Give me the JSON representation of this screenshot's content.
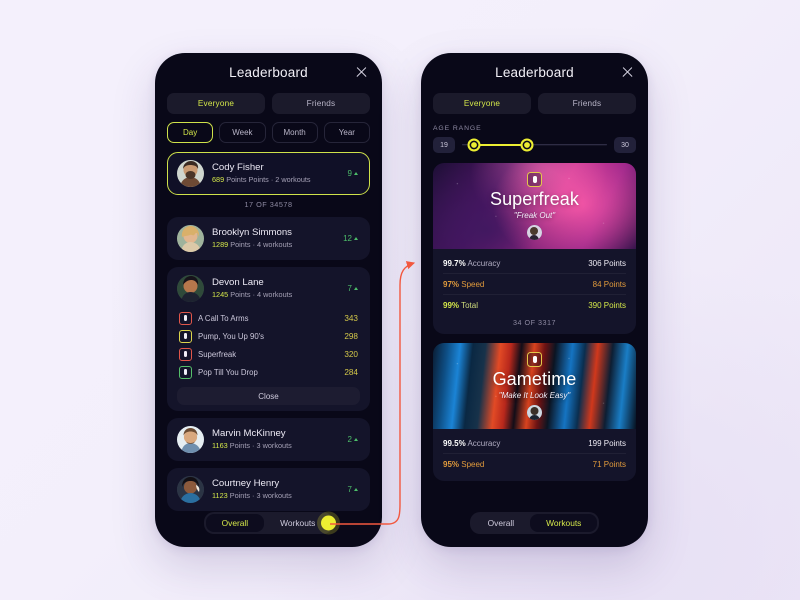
{
  "theme": {
    "accent_yellow": "#d5e84a",
    "accent_dot": "#ecee32",
    "orange": "#e09a3c",
    "green": "#4dbf6a",
    "card_bg": "#14142a",
    "phone_bg": "#090818",
    "page_bg": "#f2eefb",
    "connector": "#f2583f"
  },
  "left_phone": {
    "header": {
      "title": "Leaderboard",
      "close_icon": "close-icon"
    },
    "audience_tabs": [
      {
        "label": "Everyone",
        "active": true
      },
      {
        "label": "Friends",
        "active": false
      }
    ],
    "period_tabs": [
      {
        "label": "Day",
        "active": true
      },
      {
        "label": "Week",
        "active": false
      },
      {
        "label": "Month",
        "active": false
      },
      {
        "label": "Year",
        "active": false
      }
    ],
    "entries": [
      {
        "name": "Cody Fisher",
        "points": "689",
        "sub": " Points Points · 2 workouts",
        "rank": "9",
        "highlight": true,
        "meta": "17 OF 34578"
      },
      {
        "name": "Brooklyn Simmons",
        "points": "1289",
        "sub": " Points · 4 workouts",
        "rank": "12",
        "highlight": false
      },
      {
        "name": "Devon Lane",
        "points": "1245",
        "sub": " Points · 4 workouts",
        "rank": "7",
        "highlight": false,
        "expanded": true,
        "workouts": [
          {
            "name": "A Call To Arms",
            "score": "343",
            "color": "#e2564a"
          },
          {
            "name": "Pump, You Up 90's",
            "score": "298",
            "color": "#dcd44c"
          },
          {
            "name": "Superfreak",
            "score": "320",
            "color": "#e2564a"
          },
          {
            "name": "Pop Till You Drop",
            "score": "284",
            "color": "#55c06a"
          }
        ],
        "close_label": "Close"
      },
      {
        "name": "Marvin McKinney",
        "points": "1163",
        "sub": " Points · 3 workouts",
        "rank": "2",
        "highlight": false
      },
      {
        "name": "Courtney Henry",
        "points": "1123",
        "sub": " Points · 3 workouts",
        "rank": "7",
        "highlight": false
      }
    ],
    "tabbar": [
      {
        "label": "Overall",
        "active": true
      },
      {
        "label": "Workouts",
        "active": false
      }
    ]
  },
  "right_phone": {
    "header": {
      "title": "Leaderboard",
      "close_icon": "close-icon"
    },
    "audience_tabs": [
      {
        "label": "Everyone",
        "active": true
      },
      {
        "label": "Friends",
        "active": false
      }
    ],
    "age_range": {
      "label": "AGE RANGE",
      "min_value": "19",
      "max_value": "30",
      "handle_left_pct": 8,
      "handle_right_pct": 45
    },
    "cards": [
      {
        "theme": "superfreak",
        "title": "Superfreak",
        "quote": "\"Freak Out\"",
        "stats": [
          {
            "value": "99.7%",
            "label": " Accuracy",
            "points": "306 Points",
            "tone": "s-white"
          },
          {
            "value": "97%",
            "label": " Speed",
            "points": "84 Points",
            "tone": "s-orange"
          },
          {
            "value": "99%",
            "label": " Total",
            "points": "390 Points",
            "tone": "s-green"
          }
        ],
        "meta": "34 OF 3317"
      },
      {
        "theme": "gametime",
        "title": "Gametime",
        "quote": "\"Make It Look Easy\"",
        "stats": [
          {
            "value": "99.5%",
            "label": " Accuracy",
            "points": "199 Points",
            "tone": "s-white"
          },
          {
            "value": "95%",
            "label": " Speed",
            "points": "71 Points",
            "tone": "s-orange"
          }
        ],
        "meta": ""
      }
    ],
    "tabbar": [
      {
        "label": "Overall",
        "active": false
      },
      {
        "label": "Workouts",
        "active": true
      }
    ]
  }
}
